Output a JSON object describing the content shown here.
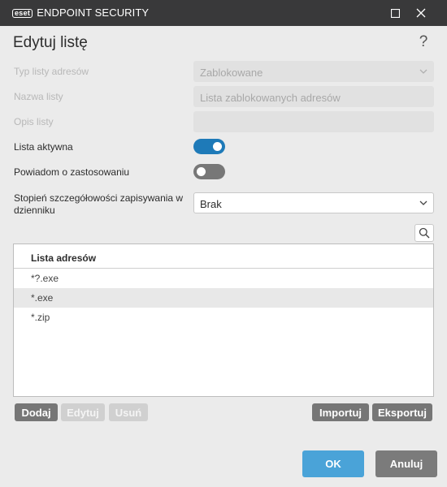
{
  "window": {
    "logo_badge": "eset",
    "app_title": "ENDPOINT SECURITY",
    "maximize_icon": "maximize-icon",
    "close_icon": "close-icon"
  },
  "dialog": {
    "title": "Edytuj listę",
    "help": "?"
  },
  "form": {
    "list_type": {
      "label": "Typ listy adresów",
      "value": "Zablokowane"
    },
    "list_name": {
      "label": "Nazwa listy",
      "value": "Lista zablokowanych adresów"
    },
    "list_desc": {
      "label": "Opis listy",
      "value": ""
    },
    "list_active": {
      "label": "Lista aktywna",
      "on": true
    },
    "notify_on_apply": {
      "label": "Powiadom o zastosowaniu",
      "on": false
    },
    "log_verbosity": {
      "label": "Stopień szczegółowości zapisywania w dzienniku",
      "value": "Brak"
    }
  },
  "table": {
    "header": "Lista adresów",
    "rows": [
      "*?.exe",
      "*.exe",
      "*.zip"
    ],
    "selected_index": 1
  },
  "actions": {
    "add": "Dodaj",
    "edit": "Edytuj",
    "remove": "Usuń",
    "import": "Importuj",
    "export": "Eksportuj"
  },
  "footer": {
    "ok": "OK",
    "cancel": "Anuluj"
  },
  "colors": {
    "titlebar": "#39393a",
    "accent": "#1e7ab8",
    "ok_button": "#4aa3d8"
  }
}
